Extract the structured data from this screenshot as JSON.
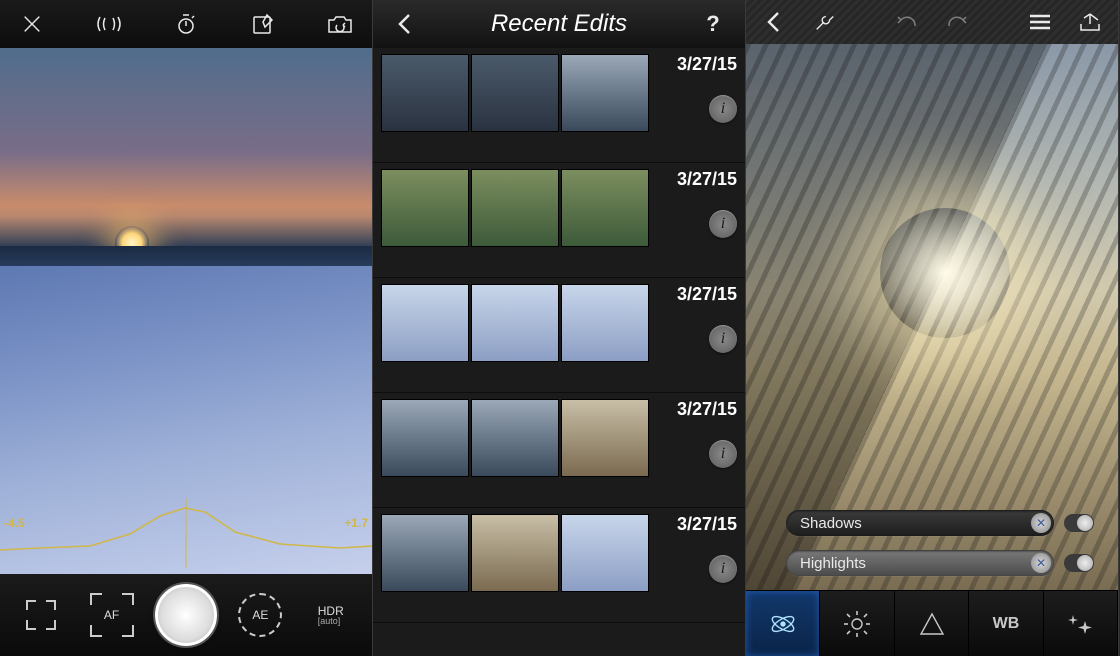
{
  "pane1": {
    "top_icons": {
      "close": "close-icon",
      "bracket": "exposure-bracket-icon",
      "timer": "timer-icon",
      "compose": "compose-icon",
      "switch_camera": "switch-camera-icon"
    },
    "histogram": {
      "ev_left": "-4.5",
      "ev_right": "+1.7"
    },
    "bottom": {
      "frame": "aspect-crop-icon",
      "af_label": "AF",
      "ae_label": "AE",
      "hdr_label": "HDR",
      "hdr_sub": "[auto]"
    }
  },
  "pane2": {
    "title": "Recent Edits",
    "back_icon": "chevron-left-icon",
    "help_icon": "help-icon",
    "help_glyph": "?",
    "info_glyph": "i",
    "rows": [
      {
        "date": "3/27/15"
      },
      {
        "date": "3/27/15"
      },
      {
        "date": "3/27/15"
      },
      {
        "date": "3/27/15"
      },
      {
        "date": "3/27/15"
      }
    ]
  },
  "pane3": {
    "top": {
      "back": "chevron-left-icon",
      "tools": "wrench-icon",
      "undo": "undo-icon",
      "redo": "redo-icon",
      "menu": "menu-icon",
      "share": "share-icon"
    },
    "sliders": [
      {
        "key": "shadows",
        "label": "Shadows"
      },
      {
        "key": "highlights",
        "label": "Highlights"
      }
    ],
    "tools": [
      {
        "key": "tone",
        "active": true,
        "icon": "atom-icon"
      },
      {
        "key": "brightness",
        "active": false,
        "icon": "sun-icon"
      },
      {
        "key": "sharpen",
        "active": false,
        "icon": "triangle-icon"
      },
      {
        "key": "white_balance",
        "active": false,
        "label": "WB"
      },
      {
        "key": "effects",
        "active": false,
        "icon": "sparkle-icon"
      }
    ]
  }
}
